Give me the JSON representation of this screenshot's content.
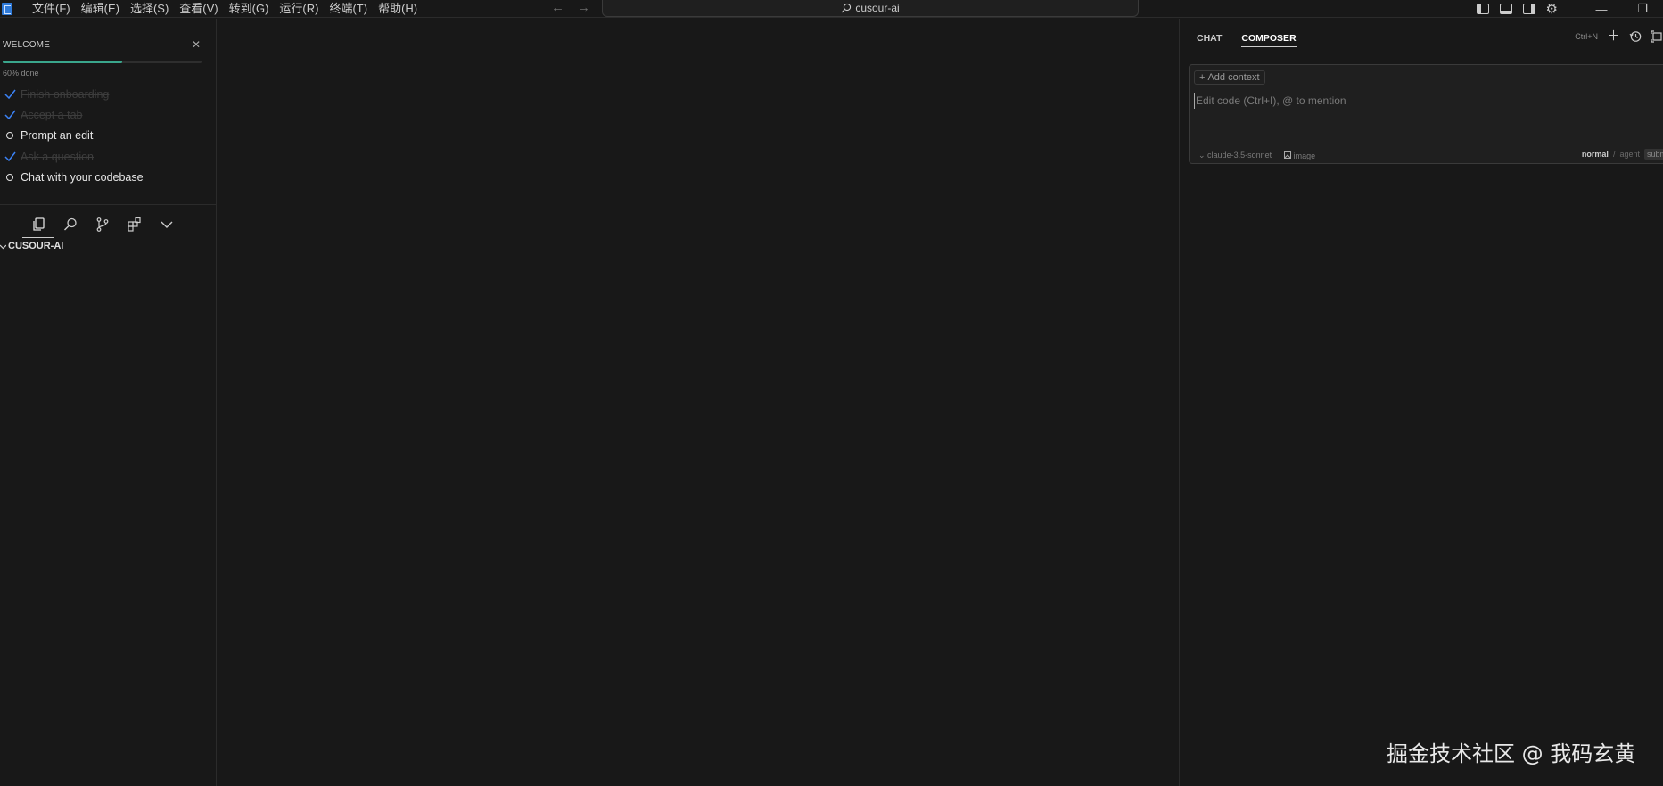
{
  "menu": [
    "文件(F)",
    "编辑(E)",
    "选择(S)",
    "查看(V)",
    "转到(G)",
    "运行(R)",
    "终端(T)",
    "帮助(H)"
  ],
  "search": {
    "title": "cusour-ai"
  },
  "welcome": {
    "title": "WELCOME",
    "progress": 0.6,
    "progress_text": "60% done",
    "items": [
      {
        "label": "Finish onboarding",
        "done": true
      },
      {
        "label": "Accept a tab",
        "done": true
      },
      {
        "label": "Prompt an edit",
        "done": false
      },
      {
        "label": "Ask a question",
        "done": true
      },
      {
        "label": "Chat with your codebase",
        "done": false
      }
    ]
  },
  "explorer": {
    "title": "CUSOUR-AI"
  },
  "panel": {
    "tabs": [
      "CHAT",
      "COMPOSER"
    ],
    "active_tab": "COMPOSER",
    "shortcut": "Ctrl+N",
    "add_context": "Add context",
    "placeholder": "Edit code (Ctrl+I), @ to mention",
    "model": "claude-3.5-sonnet",
    "image_label": "image",
    "mode_normal": "normal",
    "mode_separator": "/",
    "mode_agent": "agent",
    "submit": "subm"
  },
  "watermark": "掘金技术社区 @ 我码玄黄",
  "colors": {
    "accent_progress": "#3aa68c",
    "check_blue": "#3b82f6",
    "background": "#181818"
  }
}
